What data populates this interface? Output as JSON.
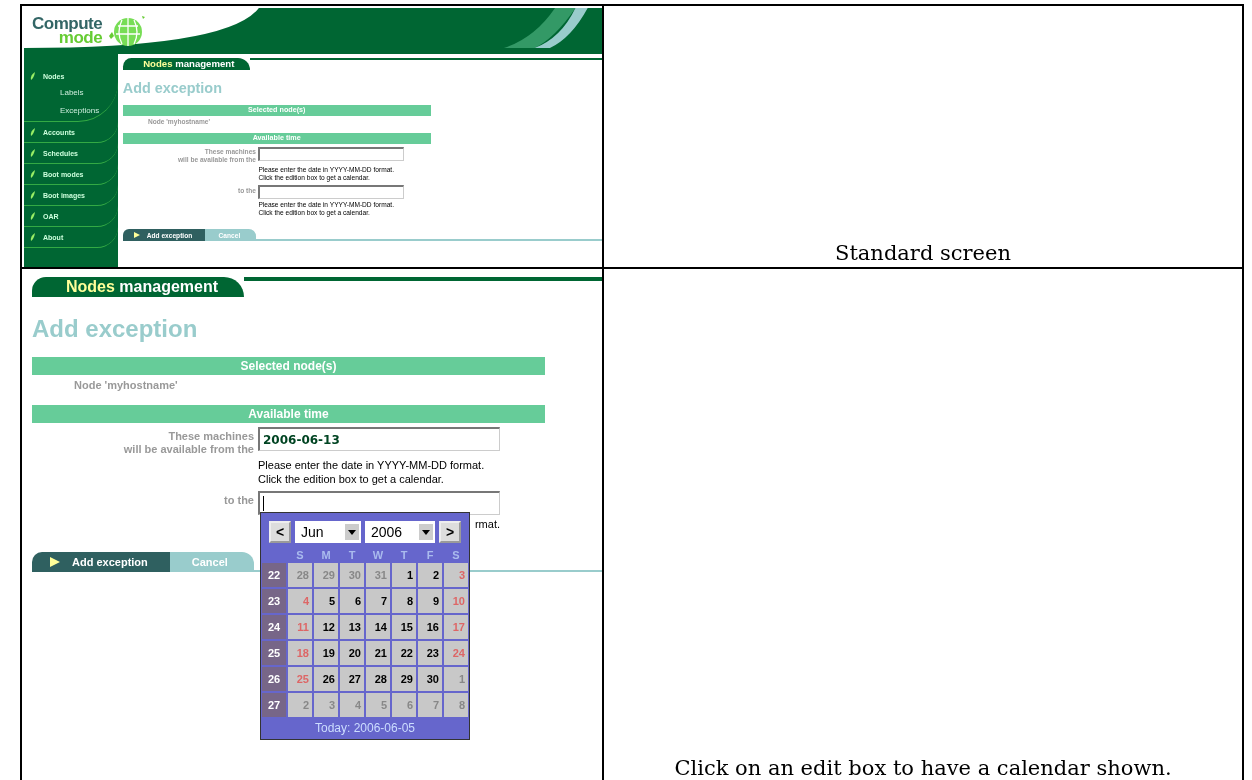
{
  "rows": [
    {
      "screen": {
        "logo": {
          "first": "Compute",
          "second": "mode"
        },
        "sidebar": [
          {
            "label": "Nodes",
            "children": [
              {
                "label": "Labels"
              },
              {
                "label": "Exceptions"
              }
            ]
          },
          {
            "label": "Accounts"
          },
          {
            "label": "Schedules"
          },
          {
            "label": "Boot modes"
          },
          {
            "label": "Boot images"
          },
          {
            "label": "OAR"
          },
          {
            "label": "About"
          }
        ],
        "form": {
          "tab": {
            "highlight": "Nodes",
            "rest": "management"
          },
          "heading": "Add exception",
          "sections": [
            {
              "title": "Selected node(s)",
              "text": "Node 'myhostname'"
            },
            {
              "title": "Available time"
            }
          ],
          "fields": [
            {
              "label": [
                "These machines",
                "will be available from the"
              ],
              "focused": false,
              "help": [
                "Please enter the date in YYYY-MM-DD format.",
                "Click the edition box to get a calendar."
              ]
            },
            {
              "label": [
                "to the"
              ],
              "focused": false,
              "help": [
                "Please enter the date in YYYY-MM-DD format.",
                "Click the edition box to get a calendar."
              ]
            }
          ],
          "buttons": [
            {
              "label": "Add exception",
              "kind": "primary"
            },
            {
              "label": "Cancel",
              "kind": "secondary"
            }
          ]
        }
      },
      "caption": "Standard screen"
    },
    {
      "screen": {
        "form": {
          "tab": {
            "highlight": "Nodes",
            "rest": "management"
          },
          "heading": "Add exception",
          "sections": [
            {
              "title": "Selected node(s)",
              "text": "Node 'myhostname'"
            },
            {
              "title": "Available time"
            }
          ],
          "fields": [
            {
              "label": [
                "These machines",
                "will be available from the"
              ],
              "value": "2006-06-13",
              "focused": false,
              "help": [
                "Please enter the date in YYYY-MM-DD format.",
                "Click the edition box to get a calendar."
              ]
            },
            {
              "label": [
                "to the"
              ],
              "focused": true,
              "help": [
                "rmat."
              ]
            }
          ],
          "buttons": [
            {
              "label": "Add exception",
              "kind": "primary"
            },
            {
              "label": "Cancel",
              "kind": "secondary"
            }
          ]
        },
        "calendar": {
          "prev": "<",
          "month": "Jun",
          "year": "2006",
          "next": ">",
          "weekdays": [
            "S",
            "M",
            "T",
            "W",
            "T",
            "F",
            "S"
          ],
          "weeks": [
            {
              "number": "22",
              "days": [
                {
                  "label": "28",
                  "kind": "other"
                },
                {
                  "label": "29",
                  "kind": "other"
                },
                {
                  "label": "30",
                  "kind": "other"
                },
                {
                  "label": "31",
                  "kind": "other"
                },
                {
                  "label": "1",
                  "kind": "day"
                },
                {
                  "label": "2",
                  "kind": "day"
                },
                {
                  "label": "3",
                  "kind": "weekend"
                }
              ]
            },
            {
              "number": "23",
              "days": [
                {
                  "label": "4",
                  "kind": "weekend"
                },
                {
                  "label": "5",
                  "kind": "day"
                },
                {
                  "label": "6",
                  "kind": "day"
                },
                {
                  "label": "7",
                  "kind": "day"
                },
                {
                  "label": "8",
                  "kind": "day"
                },
                {
                  "label": "9",
                  "kind": "day"
                },
                {
                  "label": "10",
                  "kind": "weekend"
                }
              ]
            },
            {
              "number": "24",
              "days": [
                {
                  "label": "11",
                  "kind": "weekend"
                },
                {
                  "label": "12",
                  "kind": "day"
                },
                {
                  "label": "13",
                  "kind": "day"
                },
                {
                  "label": "14",
                  "kind": "day"
                },
                {
                  "label": "15",
                  "kind": "day"
                },
                {
                  "label": "16",
                  "kind": "day"
                },
                {
                  "label": "17",
                  "kind": "weekend"
                }
              ]
            },
            {
              "number": "25",
              "days": [
                {
                  "label": "18",
                  "kind": "weekend"
                },
                {
                  "label": "19",
                  "kind": "day"
                },
                {
                  "label": "20",
                  "kind": "day"
                },
                {
                  "label": "21",
                  "kind": "day"
                },
                {
                  "label": "22",
                  "kind": "day"
                },
                {
                  "label": "23",
                  "kind": "day"
                },
                {
                  "label": "24",
                  "kind": "weekend"
                }
              ]
            },
            {
              "number": "26",
              "days": [
                {
                  "label": "25",
                  "kind": "weekend"
                },
                {
                  "label": "26",
                  "kind": "day"
                },
                {
                  "label": "27",
                  "kind": "day"
                },
                {
                  "label": "28",
                  "kind": "day"
                },
                {
                  "label": "29",
                  "kind": "day"
                },
                {
                  "label": "30",
                  "kind": "day"
                },
                {
                  "label": "1",
                  "kind": "other"
                }
              ]
            },
            {
              "number": "27",
              "days": [
                {
                  "label": "2",
                  "kind": "other"
                },
                {
                  "label": "3",
                  "kind": "other"
                },
                {
                  "label": "4",
                  "kind": "other"
                },
                {
                  "label": "5",
                  "kind": "other"
                },
                {
                  "label": "6",
                  "kind": "other"
                },
                {
                  "label": "7",
                  "kind": "other"
                },
                {
                  "label": "8",
                  "kind": "other"
                }
              ]
            }
          ],
          "today": "Today: 2006-06-05"
        }
      },
      "caption": "Click on an edit box to have a calendar shown."
    }
  ]
}
